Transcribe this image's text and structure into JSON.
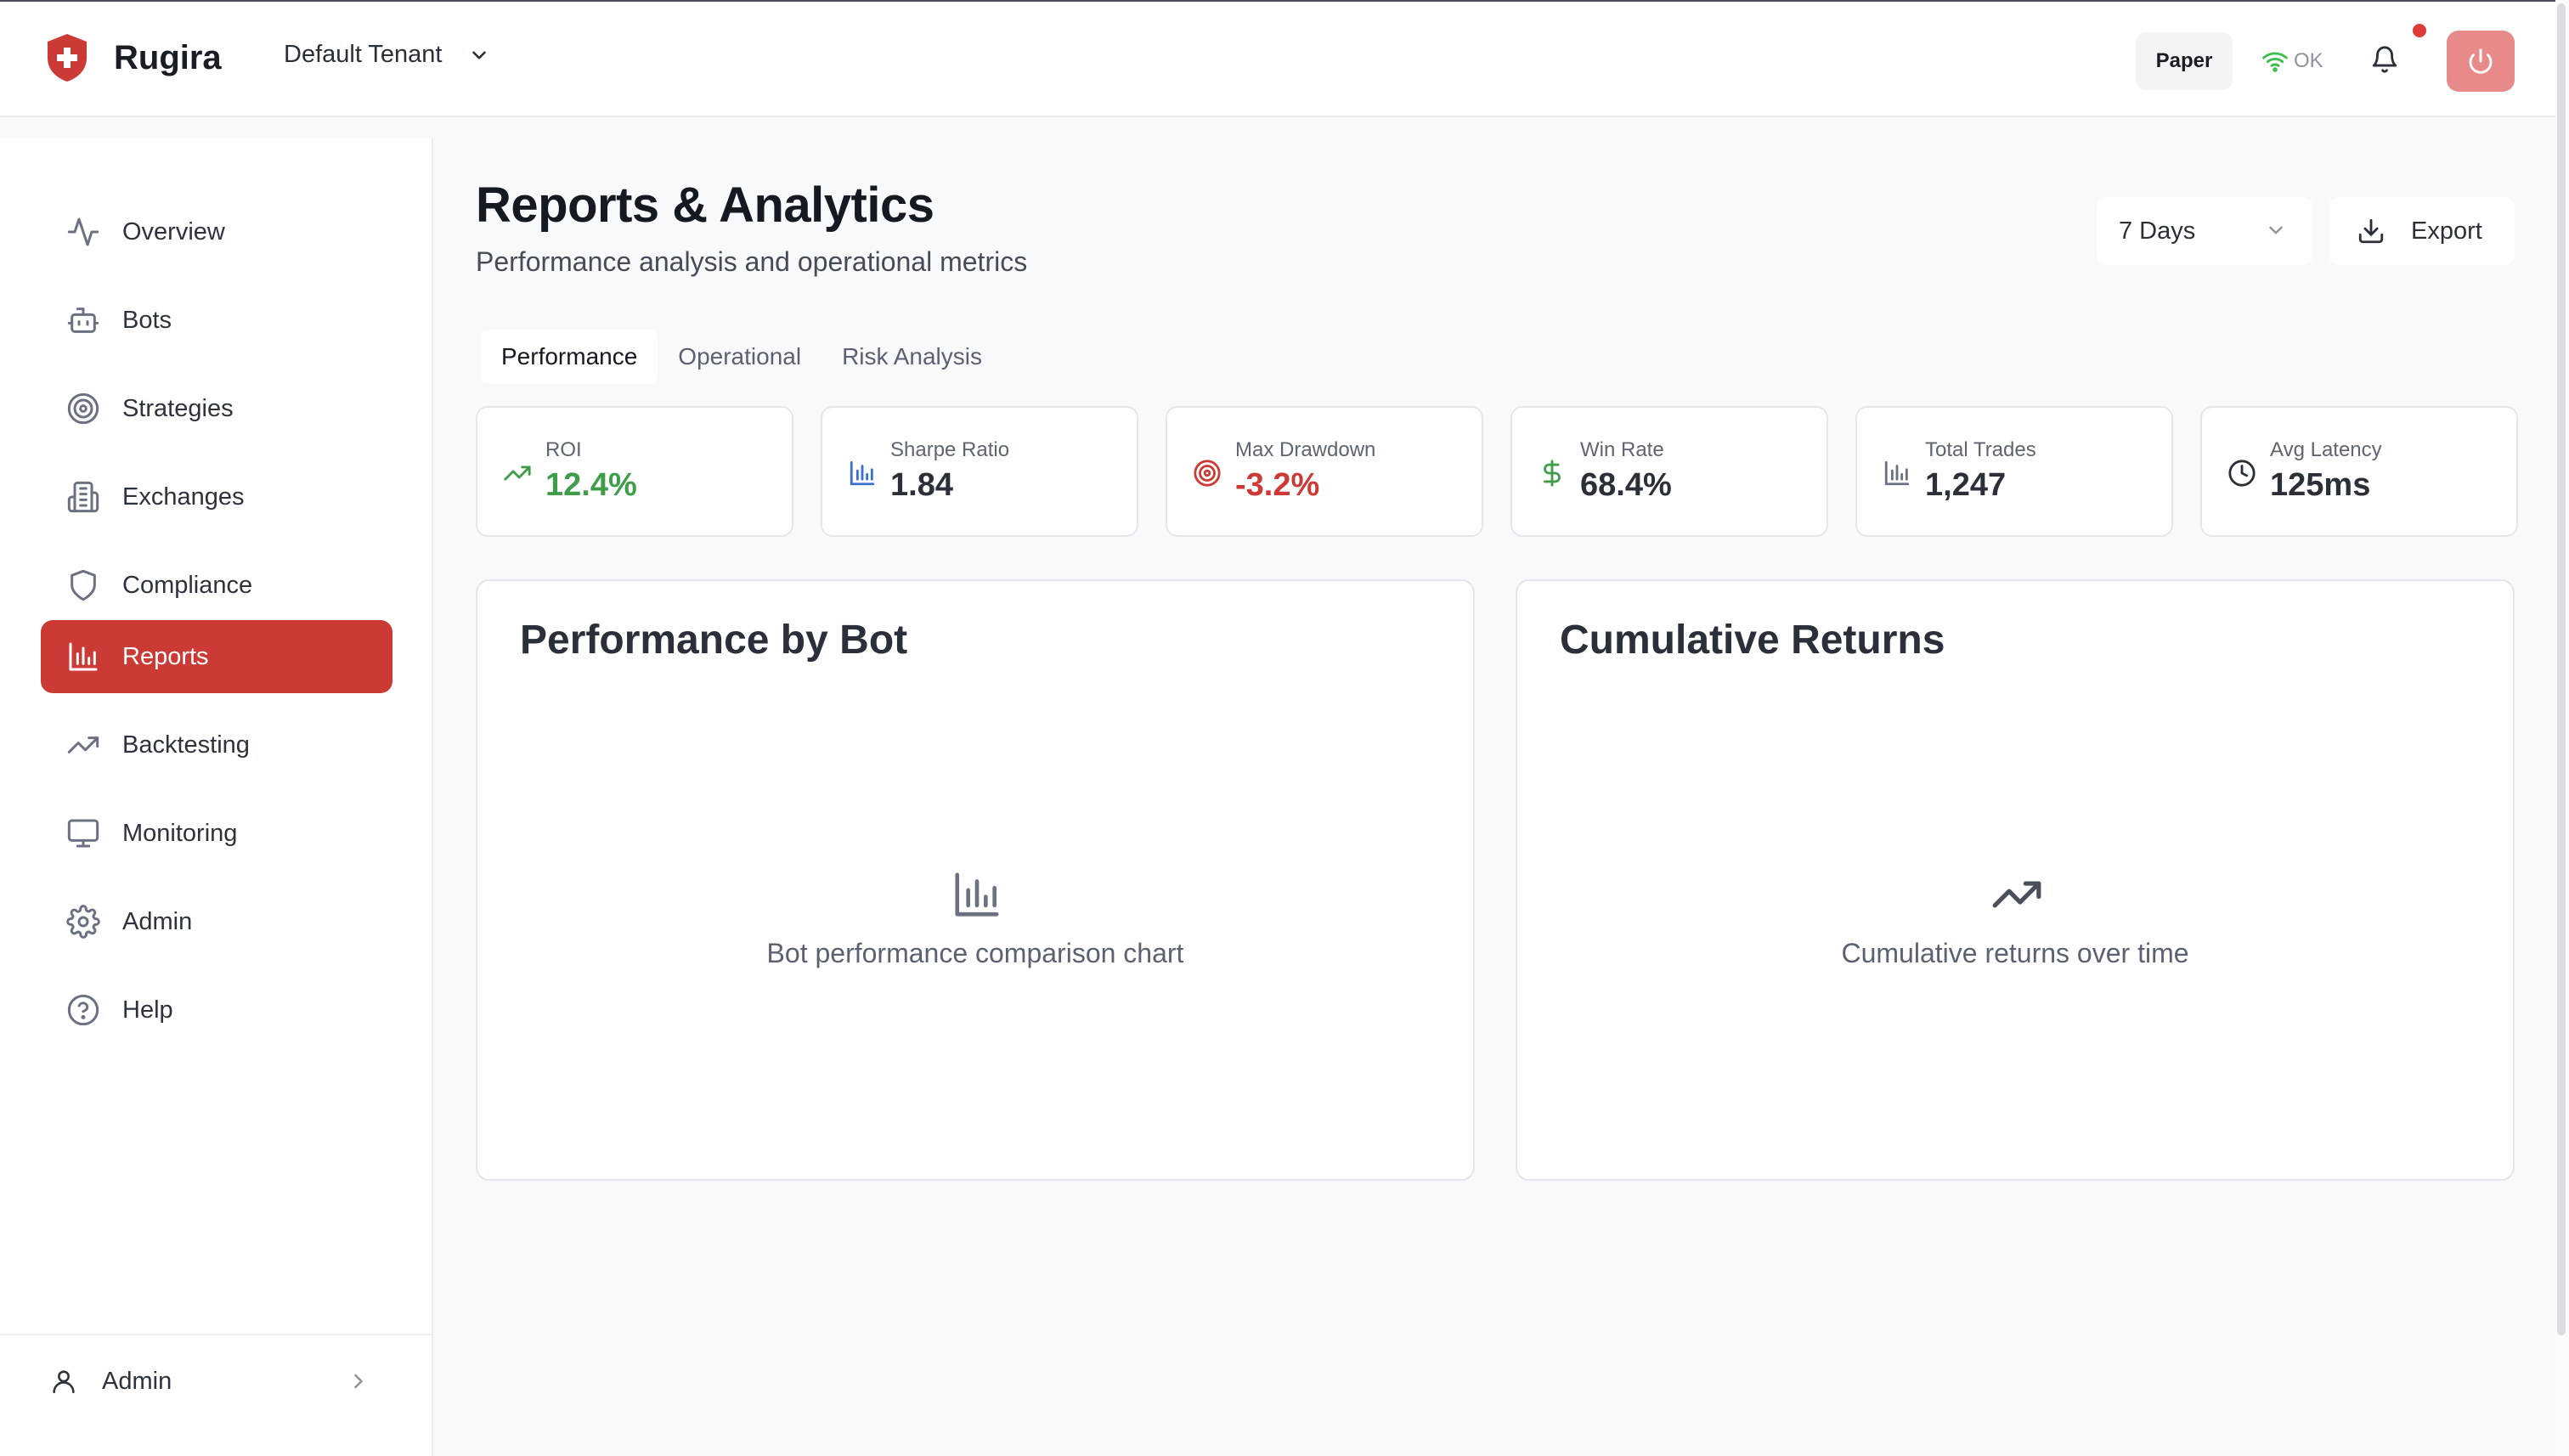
{
  "app": {
    "brand_name": "Rugira",
    "tenant": "Default Tenant"
  },
  "header": {
    "mode_label": "Paper",
    "connection_status": "OK"
  },
  "sidebar": {
    "items": [
      {
        "label": "Overview",
        "icon": "activity-icon"
      },
      {
        "label": "Bots",
        "icon": "bot-icon"
      },
      {
        "label": "Strategies",
        "icon": "target-icon"
      },
      {
        "label": "Exchanges",
        "icon": "building-icon"
      },
      {
        "label": "Compliance",
        "icon": "shield-icon"
      },
      {
        "label": "Reports",
        "icon": "bar-chart-icon",
        "active": true
      },
      {
        "label": "Backtesting",
        "icon": "trending-up-icon"
      },
      {
        "label": "Monitoring",
        "icon": "monitor-icon"
      },
      {
        "label": "Admin",
        "icon": "gear-icon"
      },
      {
        "label": "Help",
        "icon": "help-circle-icon"
      }
    ],
    "user": {
      "label": "Admin"
    }
  },
  "page": {
    "title": "Reports & Analytics",
    "subtitle": "Performance analysis and operational metrics",
    "range": "7 Days",
    "export_label": "Export"
  },
  "tabs": [
    {
      "label": "Performance",
      "active": true
    },
    {
      "label": "Operational"
    },
    {
      "label": "Risk Analysis"
    }
  ],
  "kpis": [
    {
      "label": "ROI",
      "value": "12.4%",
      "icon": "trending-up-icon",
      "color": "#3f9d4a"
    },
    {
      "label": "Sharpe Ratio",
      "value": "1.84",
      "icon": "bar-chart-icon",
      "color": "#2b2f38"
    },
    {
      "label": "Max Drawdown",
      "value": "-3.2%",
      "icon": "target-icon",
      "color": "#cc3a35"
    },
    {
      "label": "Win Rate",
      "value": "68.4%",
      "icon": "dollar-icon",
      "color": "#2b2f38"
    },
    {
      "label": "Total Trades",
      "value": "1,247",
      "icon": "bar-chart-icon",
      "color": "#2b2f38"
    },
    {
      "label": "Avg Latency",
      "value": "125ms",
      "icon": "clock-icon",
      "color": "#2b2f38"
    }
  ],
  "panels": [
    {
      "title": "Performance by Bot",
      "caption": "Bot performance comparison chart",
      "icon": "bar-chart-icon"
    },
    {
      "title": "Cumulative Returns",
      "caption": "Cumulative returns over time",
      "icon": "trending-up-icon"
    }
  ],
  "colors": {
    "brand": "#cc3a35",
    "active_nav": "#cc3a35",
    "positive": "#3f9d4a",
    "negative": "#cc3a35",
    "power_button": "#e98a8a",
    "notification_dot": "#e03b3b",
    "connection_ok": "#3fbf4f"
  }
}
